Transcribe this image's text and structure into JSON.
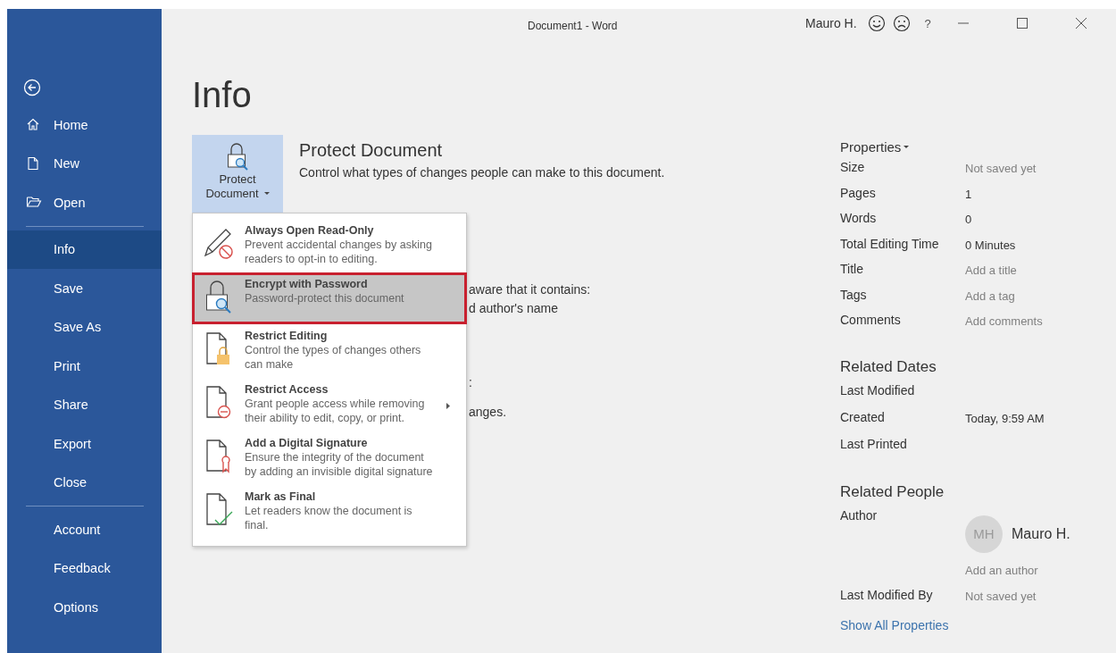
{
  "window": {
    "title": "Document1  -  Word",
    "user": "Mauro H.",
    "help": "?"
  },
  "sidebar": {
    "groups": [
      [
        {
          "label": "Home",
          "selected": false
        },
        {
          "label": "New",
          "selected": false
        },
        {
          "label": "Open",
          "selected": false
        }
      ],
      [
        {
          "label": "Info",
          "selected": true
        },
        {
          "label": "Save",
          "selected": false
        },
        {
          "label": "Save As",
          "selected": false
        },
        {
          "label": "Print",
          "selected": false
        },
        {
          "label": "Share",
          "selected": false
        },
        {
          "label": "Export",
          "selected": false
        },
        {
          "label": "Close",
          "selected": false
        }
      ],
      [
        {
          "label": "Account",
          "selected": false
        },
        {
          "label": "Feedback",
          "selected": false
        },
        {
          "label": "Options",
          "selected": false
        }
      ]
    ]
  },
  "page_title": "Info",
  "protect": {
    "button_lines": [
      "Protect",
      "Document"
    ],
    "title": "Protect Document",
    "description": "Control what types of changes people can make to this document."
  },
  "partly_hidden_texts": [
    "aware that it contains:",
    "d author's name",
    ":",
    "anges."
  ],
  "menu": {
    "items": [
      {
        "title": "Always Open Read-Only",
        "description": "Prevent accidental changes by asking readers to opt-in to editing.",
        "selected": false,
        "submenu": false
      },
      {
        "title": "Encrypt with Password",
        "description": "Password-protect this document",
        "selected": true,
        "submenu": false
      },
      {
        "title": "Restrict Editing",
        "description": "Control the types of changes others can make",
        "selected": false,
        "submenu": false
      },
      {
        "title": "Restrict Access",
        "description": "Grant people access while removing their ability to edit, copy, or print.",
        "selected": false,
        "submenu": true
      },
      {
        "title": "Add a Digital Signature",
        "description": "Ensure the integrity of the document by adding an invisible digital signature",
        "selected": false,
        "submenu": false
      },
      {
        "title": "Mark as Final",
        "description": "Let readers know the document is final.",
        "selected": false,
        "submenu": false
      }
    ]
  },
  "properties": {
    "heading": "Properties",
    "rows": [
      {
        "label": "Size",
        "value": "Not saved yet",
        "kind": "hint"
      },
      {
        "label": "Pages",
        "value": "1",
        "kind": "value"
      },
      {
        "label": "Words",
        "value": "0",
        "kind": "value"
      },
      {
        "label": "Total Editing Time",
        "value": "0 Minutes",
        "kind": "value"
      },
      {
        "label": "Title",
        "value": "Add a title",
        "kind": "hint"
      },
      {
        "label": "Tags",
        "value": "Add a tag",
        "kind": "hint"
      },
      {
        "label": "Comments",
        "value": "Add comments",
        "kind": "hint"
      }
    ]
  },
  "related_dates": {
    "heading": "Related Dates",
    "rows": [
      {
        "label": "Last Modified"
      },
      {
        "label": "Created",
        "value": "Today, 9:59 AM"
      },
      {
        "label": "Last Printed"
      }
    ]
  },
  "related_people": {
    "heading": "Related People",
    "author_label": "Author",
    "author_initials": "MH",
    "author_name": "Mauro H.",
    "add_author": "Add an author",
    "last_modified_by_label": "Last Modified By",
    "last_modified_by_value": "Not saved yet"
  },
  "show_all": "Show All Properties"
}
